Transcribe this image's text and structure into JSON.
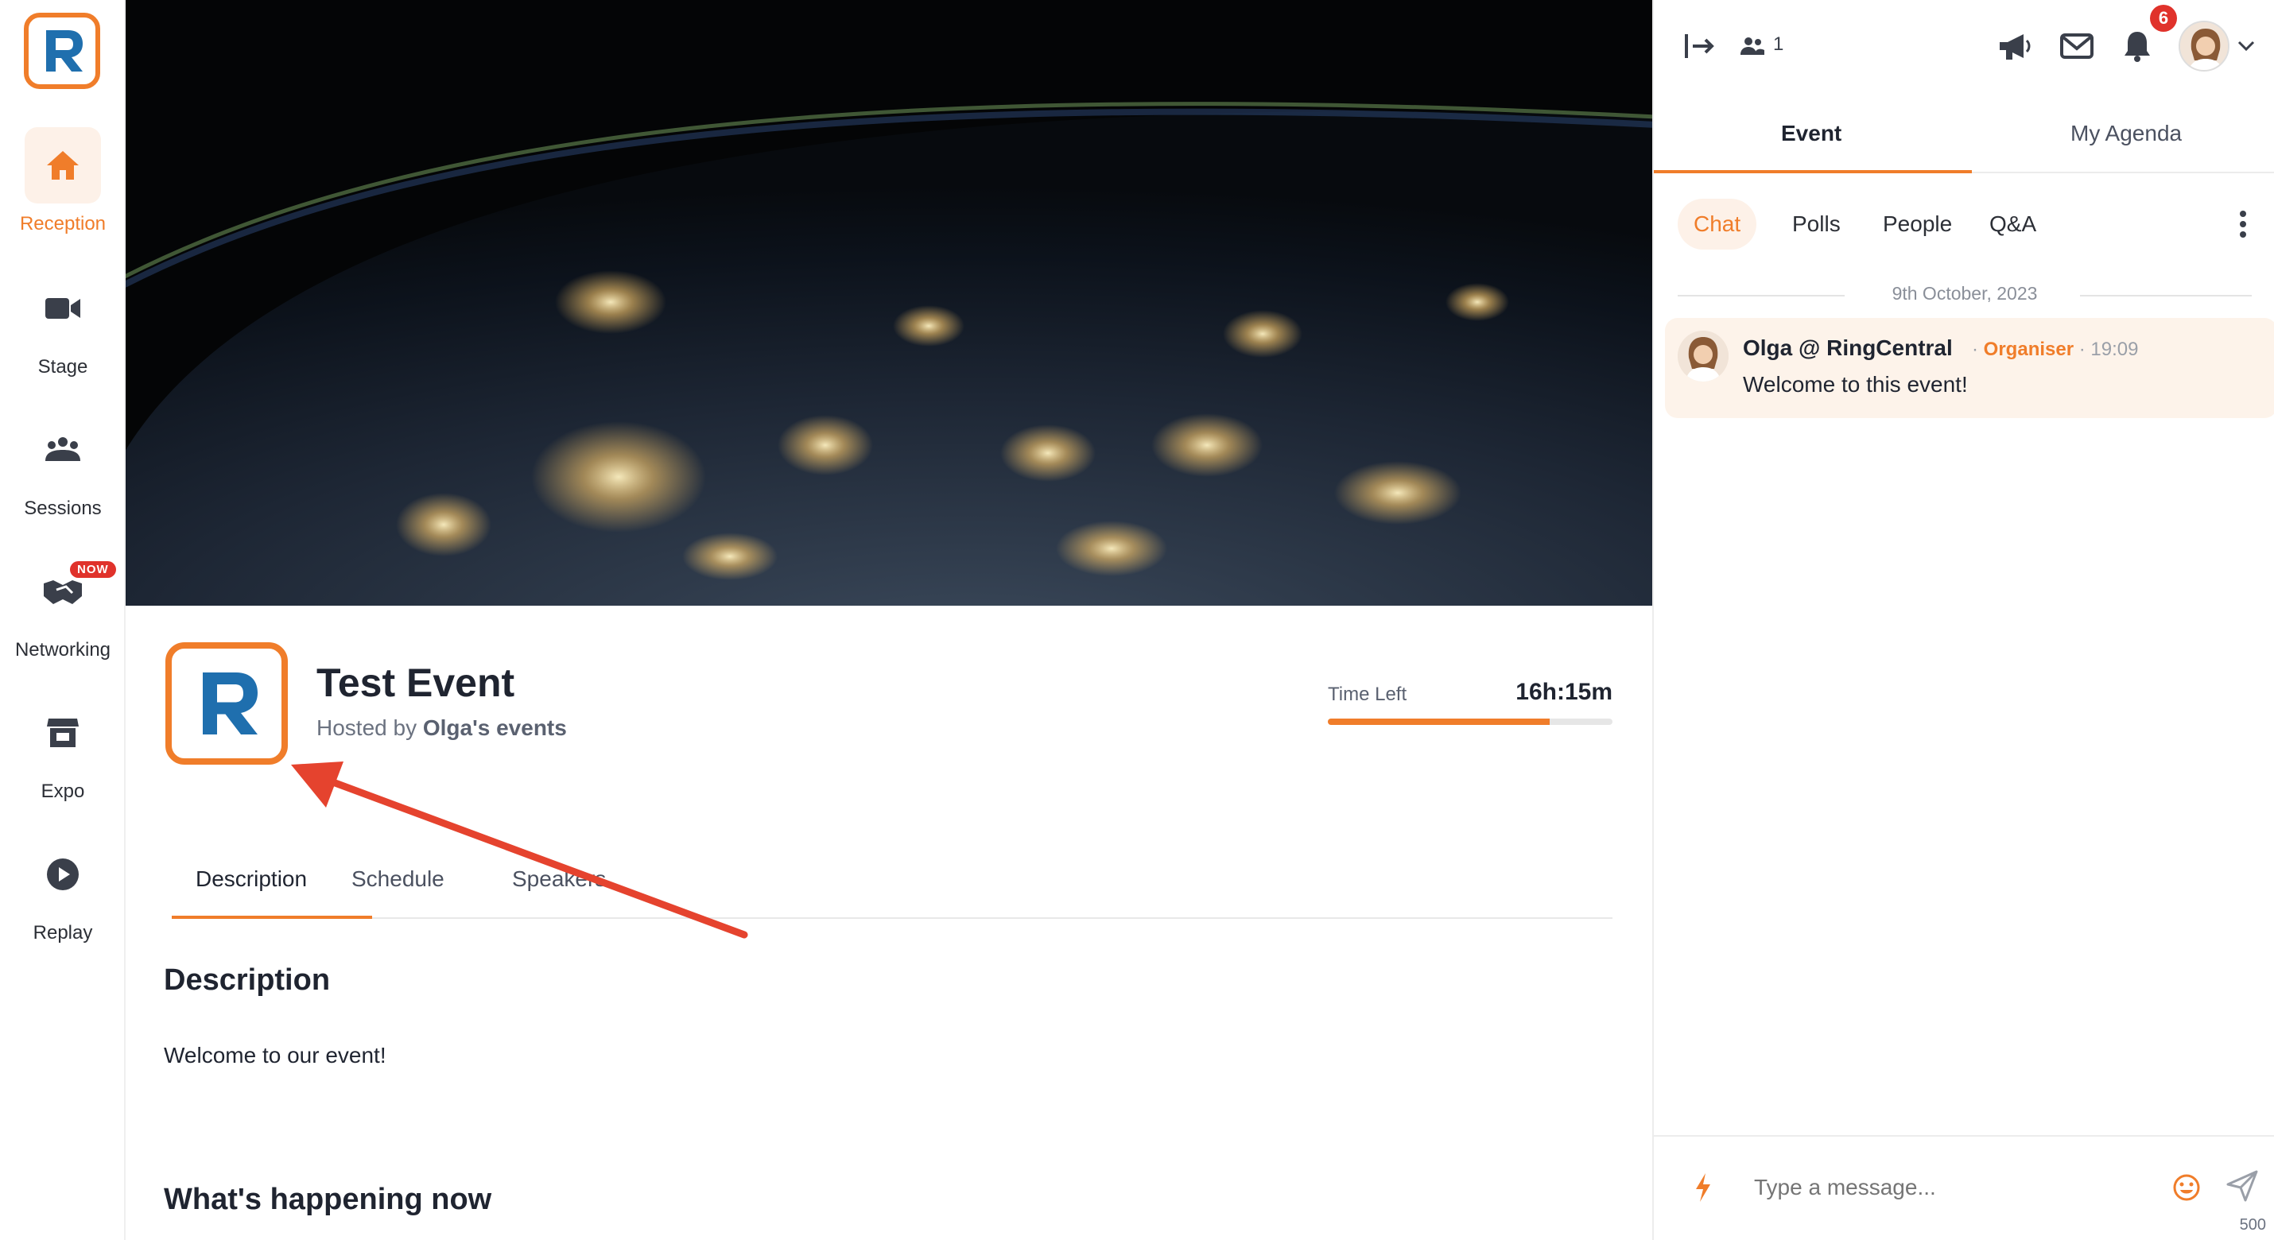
{
  "nav": {
    "logo_letter": "R",
    "items": [
      {
        "label": "Reception",
        "icon": "home-icon",
        "active": true
      },
      {
        "label": "Stage",
        "icon": "video-camera-icon",
        "active": false
      },
      {
        "label": "Sessions",
        "icon": "people-group-icon",
        "active": false
      },
      {
        "label": "Networking",
        "icon": "handshake-icon",
        "active": false,
        "badge": "NOW"
      },
      {
        "label": "Expo",
        "icon": "booth-icon",
        "active": false
      },
      {
        "label": "Replay",
        "icon": "play-circle-icon",
        "active": false
      }
    ]
  },
  "event": {
    "title": "Test Event",
    "hosted_prefix": "Hosted by",
    "host": "Olga's events",
    "time_left_label": "Time Left",
    "time_left_value": "16h:15m",
    "time_left_fraction": 0.78,
    "tabs": [
      {
        "label": "Description",
        "active": true
      },
      {
        "label": "Schedule",
        "active": false
      },
      {
        "label": "Speakers",
        "active": false
      }
    ],
    "description_heading": "Description",
    "description_text": "Welcome to our event!",
    "happening_heading": "What's happening now"
  },
  "panel": {
    "attendee_count": "1",
    "notification_count": "6",
    "tabs": [
      {
        "label": "Event",
        "active": true
      },
      {
        "label": "My Agenda",
        "active": false
      }
    ],
    "subtabs": [
      {
        "label": "Chat",
        "active": true
      },
      {
        "label": "Polls",
        "active": false
      },
      {
        "label": "People",
        "active": false
      },
      {
        "label": "Q&A",
        "active": false
      }
    ],
    "date_separator": "9th October, 2023",
    "message": {
      "author": "Olga @ RingCentral",
      "role": "Organiser",
      "time": "19:09",
      "text": "Welcome to this event!"
    },
    "composer_placeholder": "Type a message...",
    "char_limit": "500"
  },
  "colors": {
    "accent": "#f07d2a",
    "brand_blue": "#1f6fae",
    "badge_red": "#e0322b",
    "annotation_arrow": "#e5432e"
  }
}
